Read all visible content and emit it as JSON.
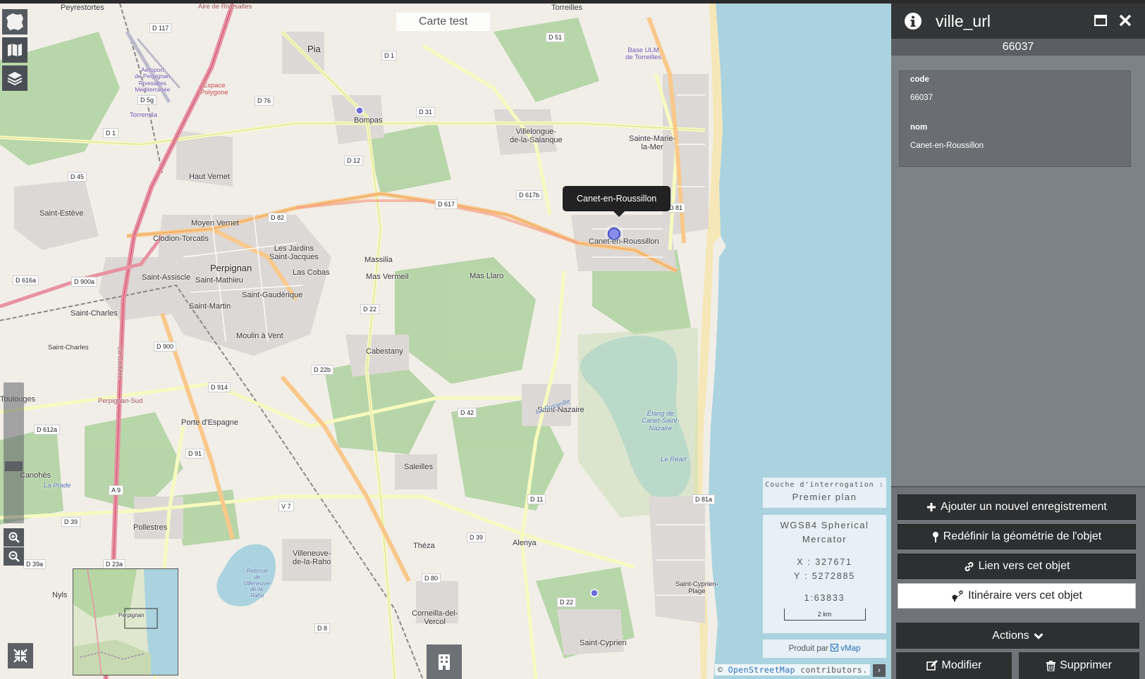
{
  "map": {
    "title": "Carte test",
    "places": [
      {
        "label": "Peyrestortes"
      },
      {
        "label": "Pia"
      },
      {
        "label": "Torreilles"
      },
      {
        "label": "Bompas"
      },
      {
        "label": "Villelongue-\nde-la-Salanque"
      },
      {
        "label": "Sainte-Marie-\nla-Mer"
      },
      {
        "label": "Haut Vernet"
      },
      {
        "label": "Saint-Estève"
      },
      {
        "label": "Moyen Vernet"
      },
      {
        "label": "Clodion-Torcatis"
      },
      {
        "label": "Les Jardins\nSaint-Jacques"
      },
      {
        "label": "Massilia"
      },
      {
        "label": "Perpignan"
      },
      {
        "label": "Mas Vermeil"
      },
      {
        "label": "Mas Llaro"
      },
      {
        "label": "Las Cobas"
      },
      {
        "label": "Saint-Assiscle"
      },
      {
        "label": "Saint-Mathieu"
      },
      {
        "label": "Saint-Gaudérique"
      },
      {
        "label": "Saint-Martin"
      },
      {
        "label": "Saint-Charles"
      },
      {
        "label": "Moulin à Vent"
      },
      {
        "label": "Cabestany"
      },
      {
        "label": "Saint-Nazaire"
      },
      {
        "label": "Toulouges"
      },
      {
        "label": "Porte d'Espagne"
      },
      {
        "label": "Canohès"
      },
      {
        "label": "Saleilles"
      },
      {
        "label": "Pollestres"
      },
      {
        "label": "Théza"
      },
      {
        "label": "Alenya"
      },
      {
        "label": "Villeneuve-\nde-la-Raho"
      },
      {
        "label": "Corneilla-del-\nVercol"
      },
      {
        "label": "Saint-Cyprien"
      },
      {
        "label": "Saint-Cyprien-\nPlage"
      },
      {
        "label": "Nyls"
      },
      {
        "label": "Canet-en-Roussillon"
      }
    ],
    "water_labels": [
      "Étang de\nCanet-Saint-\nNazaire",
      "Le Réart",
      "Retenue\nde\nVilleneuve-\nde-la-\nRaho",
      "La Fosseille"
    ],
    "other_labels": [
      "Aéroport\nde Perpignan\nRivesaltes\nMéditerranée",
      "Base ULM\nde Torreilles",
      "Espace\nPolygone",
      "Torremila",
      "La Prade",
      "Perpignan-Sud",
      "Aire de Rivesaltes",
      "La Cadière",
      "Saint-Charles"
    ],
    "roads": [
      "D 117",
      "D 1",
      "D 51",
      "D 5g",
      "D 76",
      "D 31",
      "D 12",
      "D 1",
      "D 45",
      "D 617b",
      "D 617",
      "D 82",
      "D 81",
      "D 616a",
      "D 900a",
      "D 22",
      "D 900",
      "D 22b",
      "D 914",
      "D 42",
      "D 612a",
      "D 91",
      "A 9",
      "D 39",
      "V 7",
      "D 11",
      "D 39",
      "D 80",
      "D 22",
      "D 23a",
      "D 39a",
      "D 8",
      "D 81a"
    ],
    "popup": "Canet-en-Roussillon",
    "query_layer": {
      "label": "Couche d'interrogation :",
      "value": "Premier plan"
    },
    "projection": "WGS84 Spherical Mercator",
    "x": "X : 327671",
    "y": "Y : 5272885",
    "scale": "1:63833",
    "scalebar": "2 km",
    "produced_by": "Produit par",
    "produced_brand": "vMap",
    "attribution_prefix": "©",
    "attribution_link": "OpenStreetMap",
    "attribution_suffix": "contributors.",
    "attribution_toggle": "›",
    "overview_label": "Perpignan"
  },
  "panel": {
    "title": "ville_url",
    "subtitle": "66037",
    "fields": [
      {
        "key": "code",
        "value": "66037"
      },
      {
        "key": "nom",
        "value": "Canet-en-Roussillon"
      }
    ],
    "buttons": {
      "add": "Ajouter un nouvel enregistrement",
      "redefine": "Redéfinir la géométrie de l'objet",
      "link": "Lien vers cet objet",
      "route": "Itinéraire vers cet objet",
      "actions": "Actions",
      "modify": "Modifier",
      "delete": "Supprimer"
    }
  },
  "colors": {
    "sea": "#aad3df",
    "forest": "#add19e",
    "residential": "#e0dfdf",
    "primary_road": "#fcd6a4",
    "motorway": "#e892a2",
    "panel_dark": "#2d2f31"
  },
  "icons": [
    "app-logo-icon",
    "map-icon",
    "layers-icon",
    "zoom-in-icon",
    "zoom-out-icon",
    "collapse-icon",
    "building-icon",
    "info-icon",
    "maximize-icon",
    "close-icon",
    "plus-icon",
    "pin-icon",
    "link-icon",
    "route-icon",
    "chevron-down-icon",
    "edit-icon",
    "trash-icon"
  ]
}
